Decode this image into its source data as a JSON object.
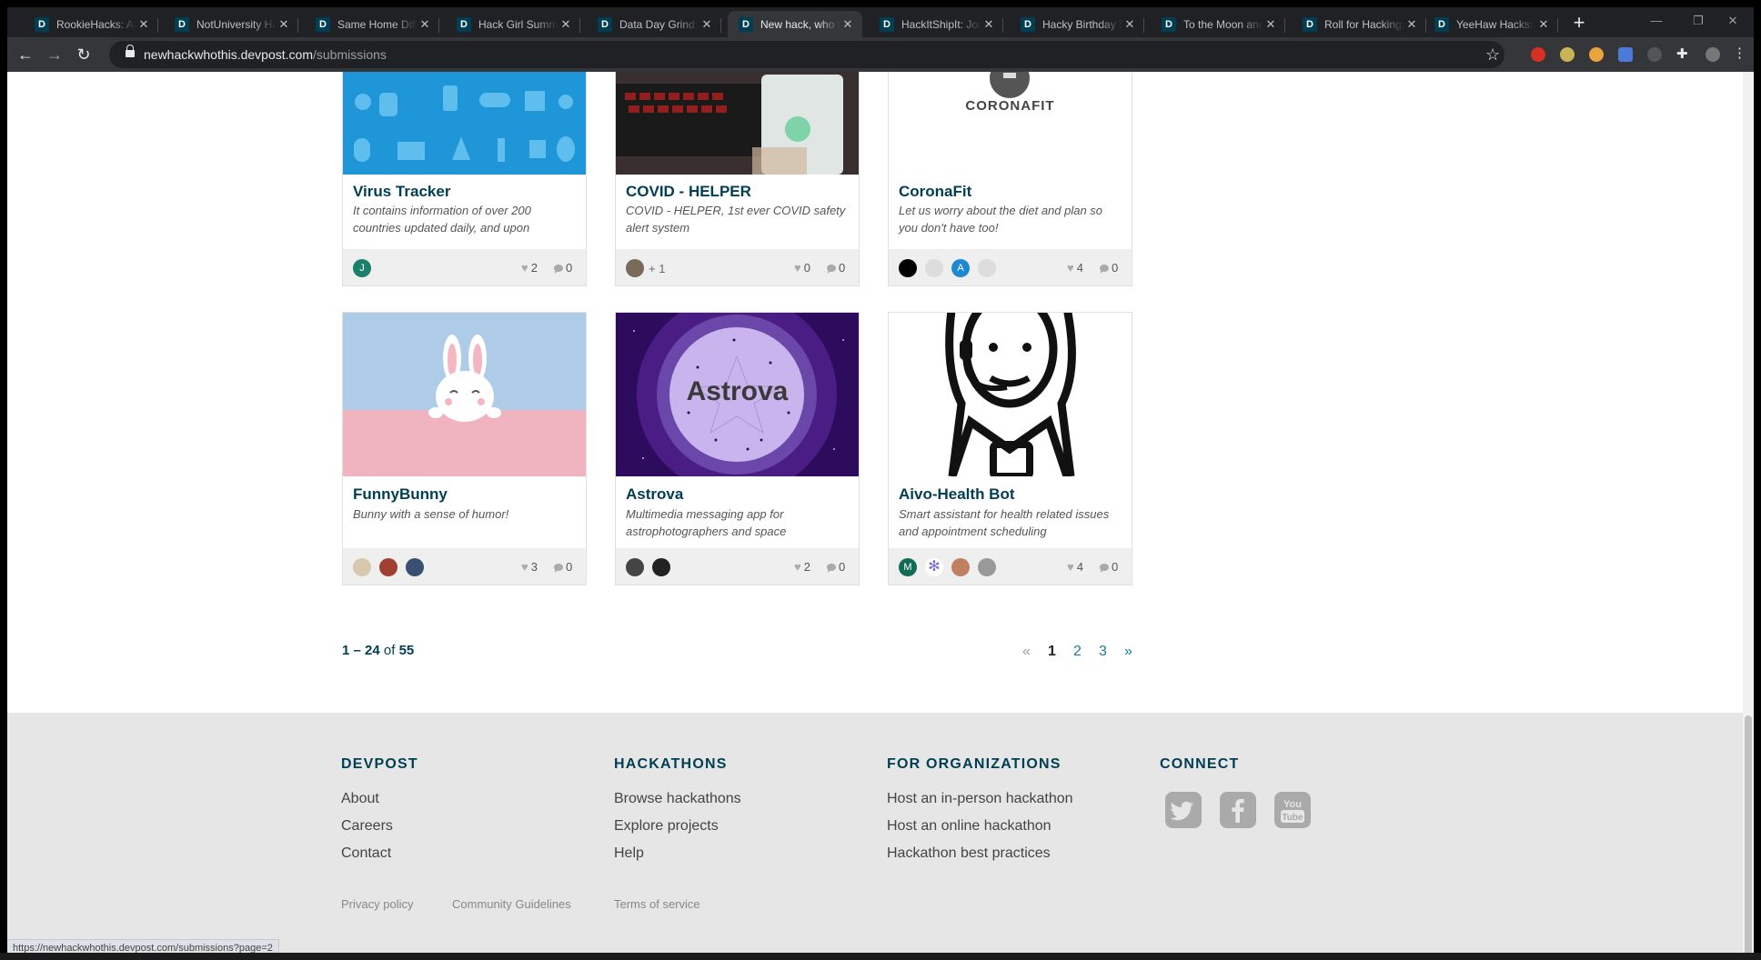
{
  "browser": {
    "tabs": [
      {
        "title": "RookieHacks: Att"
      },
      {
        "title": "NotUniversity Ha"
      },
      {
        "title": "Same Home Diffe"
      },
      {
        "title": "Hack Girl Summe"
      },
      {
        "title": "Data Day Grind: L"
      },
      {
        "title": "New hack, who t"
      },
      {
        "title": "HackItShipIt: Join"
      },
      {
        "title": "Hacky Birthday M"
      },
      {
        "title": "To the Moon and"
      },
      {
        "title": "Roll for Hacking:"
      },
      {
        "title": "YeeHaw Hacks: W"
      }
    ],
    "favicon_letter": "D",
    "url_domain": "newhackwhothis.devpost.com",
    "url_path": "/submissions",
    "status_url": "https://newhackwhothis.devpost.com/submissions?page=2"
  },
  "cards": [
    {
      "title": "Virus Tracker",
      "tagline": "It contains information of over 200 countries updated daily, and upon",
      "likes": "2",
      "comments": "0",
      "avatars": [
        "J"
      ],
      "extra_members": ""
    },
    {
      "title": "COVID - HELPER",
      "tagline": "COVID - HELPER, 1st ever COVID safety alert system",
      "likes": "0",
      "comments": "0",
      "avatars": [
        ""
      ],
      "extra_members": "+ 1"
    },
    {
      "title": "CoronaFit",
      "tagline": "Let us worry about the diet and plan so you don't have too!",
      "likes": "4",
      "comments": "0",
      "avatars": [
        "",
        "",
        "A",
        ""
      ],
      "extra_members": "",
      "image_text": "CORONAFIT"
    },
    {
      "title": "FunnyBunny",
      "tagline": "Bunny with a sense of humor!",
      "likes": "3",
      "comments": "0",
      "avatars": [
        "",
        "",
        ""
      ],
      "extra_members": ""
    },
    {
      "title": "Astrova",
      "tagline": "Multimedia messaging app for astrophotographers and space",
      "likes": "2",
      "comments": "0",
      "avatars": [
        "",
        ""
      ],
      "extra_members": "",
      "image_text": "Astrova"
    },
    {
      "title": "Aivo-Health Bot",
      "tagline": "Smart assistant for health related issues and appointment scheduling",
      "likes": "4",
      "comments": "0",
      "avatars": [
        "M",
        "",
        "",
        ""
      ],
      "extra_members": ""
    }
  ],
  "pagination": {
    "range": "1 – 24",
    "of_label": "of",
    "total": "55",
    "prev": "«",
    "pages": [
      "1",
      "2",
      "3"
    ],
    "current": "1",
    "next": "»"
  },
  "footer": {
    "columns": [
      {
        "title": "DEVPOST",
        "links": [
          "About",
          "Careers",
          "Contact"
        ]
      },
      {
        "title": "HACKATHONS",
        "links": [
          "Browse hackathons",
          "Explore projects",
          "Help"
        ]
      },
      {
        "title": "FOR ORGANIZATIONS",
        "links": [
          "Host an in-person hackathon",
          "Host an online hackathon",
          "Hackathon best practices"
        ]
      },
      {
        "title": "CONNECT",
        "links": []
      }
    ],
    "social": [
      "twitter-icon",
      "facebook-icon",
      "youtube-icon"
    ],
    "legal": [
      "Privacy policy",
      "Community Guidelines",
      "Terms of service"
    ]
  },
  "colors": {
    "brand": "#003e54",
    "link": "#1a7ba1",
    "footer_bg": "#e6e6e6"
  }
}
